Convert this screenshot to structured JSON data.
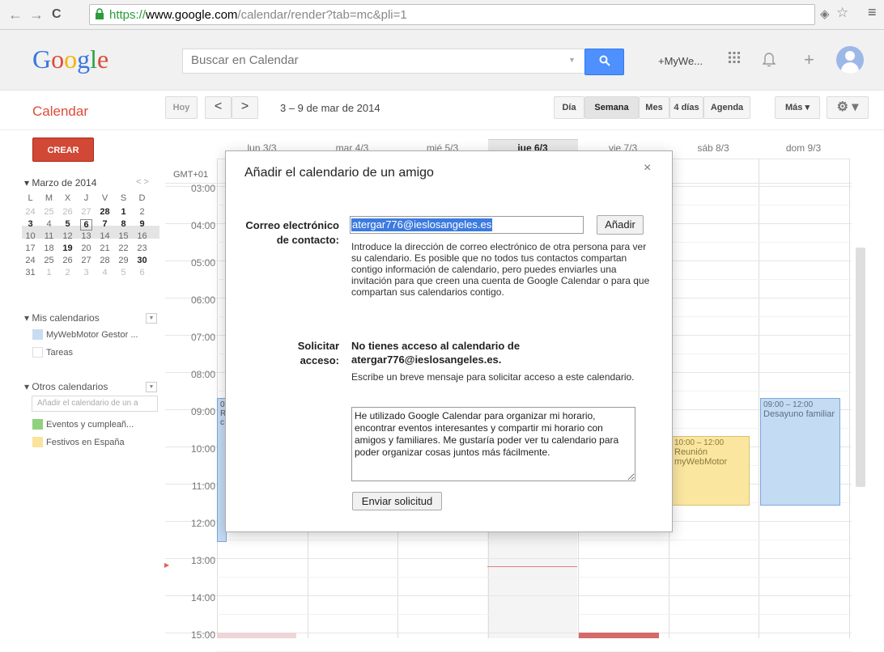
{
  "browser": {
    "back_icon": "←",
    "forward_icon": "→",
    "reload_icon": "C",
    "url_scheme": "https://",
    "url_host": "www.google.com",
    "url_path": "/calendar/render?tab=mc&pli=1",
    "ext_icon": "◈",
    "star_icon": "☆",
    "menu_icon": "≡"
  },
  "header": {
    "logo": "Google",
    "search_placeholder": "Buscar en Calendar",
    "search_btn_icon": "🔍",
    "profile_link": "+MyWe...",
    "apps_icon": "⁞⁞⁞",
    "bell_icon": "🔔",
    "share_icon": "+"
  },
  "toolbar": {
    "app_title": "Calendar",
    "today_label": "Hoy",
    "prev_icon": "<",
    "next_icon": ">",
    "date_range": "3 – 9 de mar de 2014",
    "views": [
      "Día",
      "Semana",
      "Mes",
      "4 días",
      "Agenda"
    ],
    "more_label": "Más ▾",
    "gear_label": "⚙ ▾"
  },
  "sidebar": {
    "create_label": "CREAR",
    "mini_title": "▾ Marzo de 2014",
    "mini_nav": "<  >",
    "weekdays": [
      "L",
      "M",
      "X",
      "J",
      "V",
      "S",
      "D"
    ],
    "weeks": [
      [
        "24",
        "25",
        "26",
        "27",
        "28",
        "1",
        "2"
      ],
      [
        "3",
        "4",
        "5",
        "6",
        "7",
        "8",
        "9"
      ],
      [
        "10",
        "11",
        "12",
        "13",
        "14",
        "15",
        "16"
      ],
      [
        "17",
        "18",
        "19",
        "20",
        "21",
        "22",
        "23"
      ],
      [
        "24",
        "25",
        "26",
        "27",
        "28",
        "29",
        "30"
      ],
      [
        "31",
        "1",
        "2",
        "3",
        "4",
        "5",
        "6"
      ]
    ],
    "my_calendars_title": "▾ Mis calendarios",
    "my_calendars": [
      {
        "label": "MyWebMotor Gestor ...",
        "color": "#c8dcf2"
      },
      {
        "label": "Tareas",
        "color": "#ffffff"
      }
    ],
    "other_calendars_title": "▾ Otros calendarios",
    "add_friend_placeholder": "Añadir el calendario de un a",
    "other_calendars": [
      {
        "label": "Eventos y cumpleañ...",
        "color": "#8fd17e"
      },
      {
        "label": "Festivos en España",
        "color": "#fbe39c"
      }
    ]
  },
  "calendar": {
    "timezone": "GMT+01",
    "days": [
      "lun 3/3",
      "mar 4/3",
      "mié 5/3",
      "jue 6/3",
      "vie 7/3",
      "sáb 8/3",
      "dom 9/3"
    ],
    "hours": [
      "03:00",
      "04:00",
      "05:00",
      "06:00",
      "07:00",
      "08:00",
      "09:00",
      "10:00",
      "11:00",
      "12:00",
      "13:00",
      "14:00",
      "15:00"
    ],
    "events": [
      {
        "time": "09:00 – 12:00",
        "title": "Desayuno familiar",
        "color": "#c4dbf4",
        "border": "#7ba8da"
      },
      {
        "time": "10:00 – 12:00",
        "title": "Reunión myWebMotor",
        "color": "#fbe6a0",
        "border": "#d8c173"
      },
      {
        "time": "0",
        "title": "R c",
        "color": "#c4dbf4",
        "border": "#7ba8da"
      }
    ]
  },
  "dialog": {
    "title": "Añadir el calendario de un amigo",
    "close_icon": "×",
    "email_label": "Correo electrónico de contacto:",
    "email_value": "atergar776@ieslosangeles.es",
    "add_button": "Añadir",
    "email_help": "Introduce la dirección de correo electrónico de otra persona para ver su calendario. Es posible que no todos tus contactos compartan contigo información de calendario, pero puedes enviarles una invitación para que creen una cuenta de Google Calendar o para que compartan sus calendarios contigo.",
    "access_label": "Solicitar acceso:",
    "access_title": "No tienes acceso al calendario de atergar776@ieslosangeles.es.",
    "access_help": "Escribe un breve mensaje para solicitar acceso a este calendario.",
    "message": "He utilizado Google Calendar para organizar mi horario, encontrar eventos interesantes y compartir mi horario con amigos y familiares. Me gustaría poder ver tu calendario para poder organizar cosas juntos más fácilmente.",
    "send_button": "Enviar solicitud"
  }
}
